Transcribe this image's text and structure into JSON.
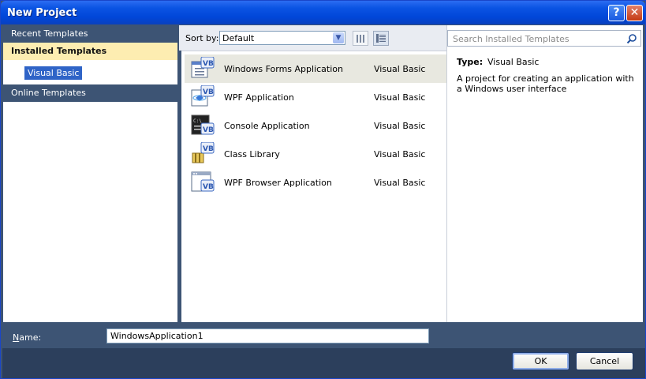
{
  "window": {
    "title": "New Project",
    "help_label": "?",
    "close_label": "✕"
  },
  "nav": {
    "recent": "Recent Templates",
    "installed": "Installed Templates",
    "sub_selected": "Visual Basic",
    "online": "Online Templates"
  },
  "toolbar": {
    "sort_label": "Sort by:",
    "sort_value": "Default",
    "sort_arrow": "▼"
  },
  "templates": [
    {
      "name": "Windows Forms Application",
      "lang": "Visual Basic",
      "icon": "winforms-vb-icon"
    },
    {
      "name": "WPF Application",
      "lang": "Visual Basic",
      "icon": "wpf-vb-icon"
    },
    {
      "name": "Console Application",
      "lang": "Visual Basic",
      "icon": "console-vb-icon"
    },
    {
      "name": "Class Library",
      "lang": "Visual Basic",
      "icon": "class-library-vb-icon"
    },
    {
      "name": "WPF Browser Application",
      "lang": "Visual Basic",
      "icon": "wpf-browser-vb-icon"
    }
  ],
  "details": {
    "search_placeholder": "Search Installed Templates",
    "type_label": "Type:",
    "type_value": "Visual Basic",
    "description": "A project for creating an application with a Windows user interface"
  },
  "form": {
    "name_label_first": "N",
    "name_label_rest": "ame:",
    "name_value": "WindowsApplication1"
  },
  "buttons": {
    "ok": "OK",
    "cancel": "Cancel"
  },
  "colors": {
    "title_bar": "#0046d8",
    "pane_header": "#3d5474",
    "selected_nav": "#fdedb1",
    "selected_sub": "#2f64c7"
  }
}
